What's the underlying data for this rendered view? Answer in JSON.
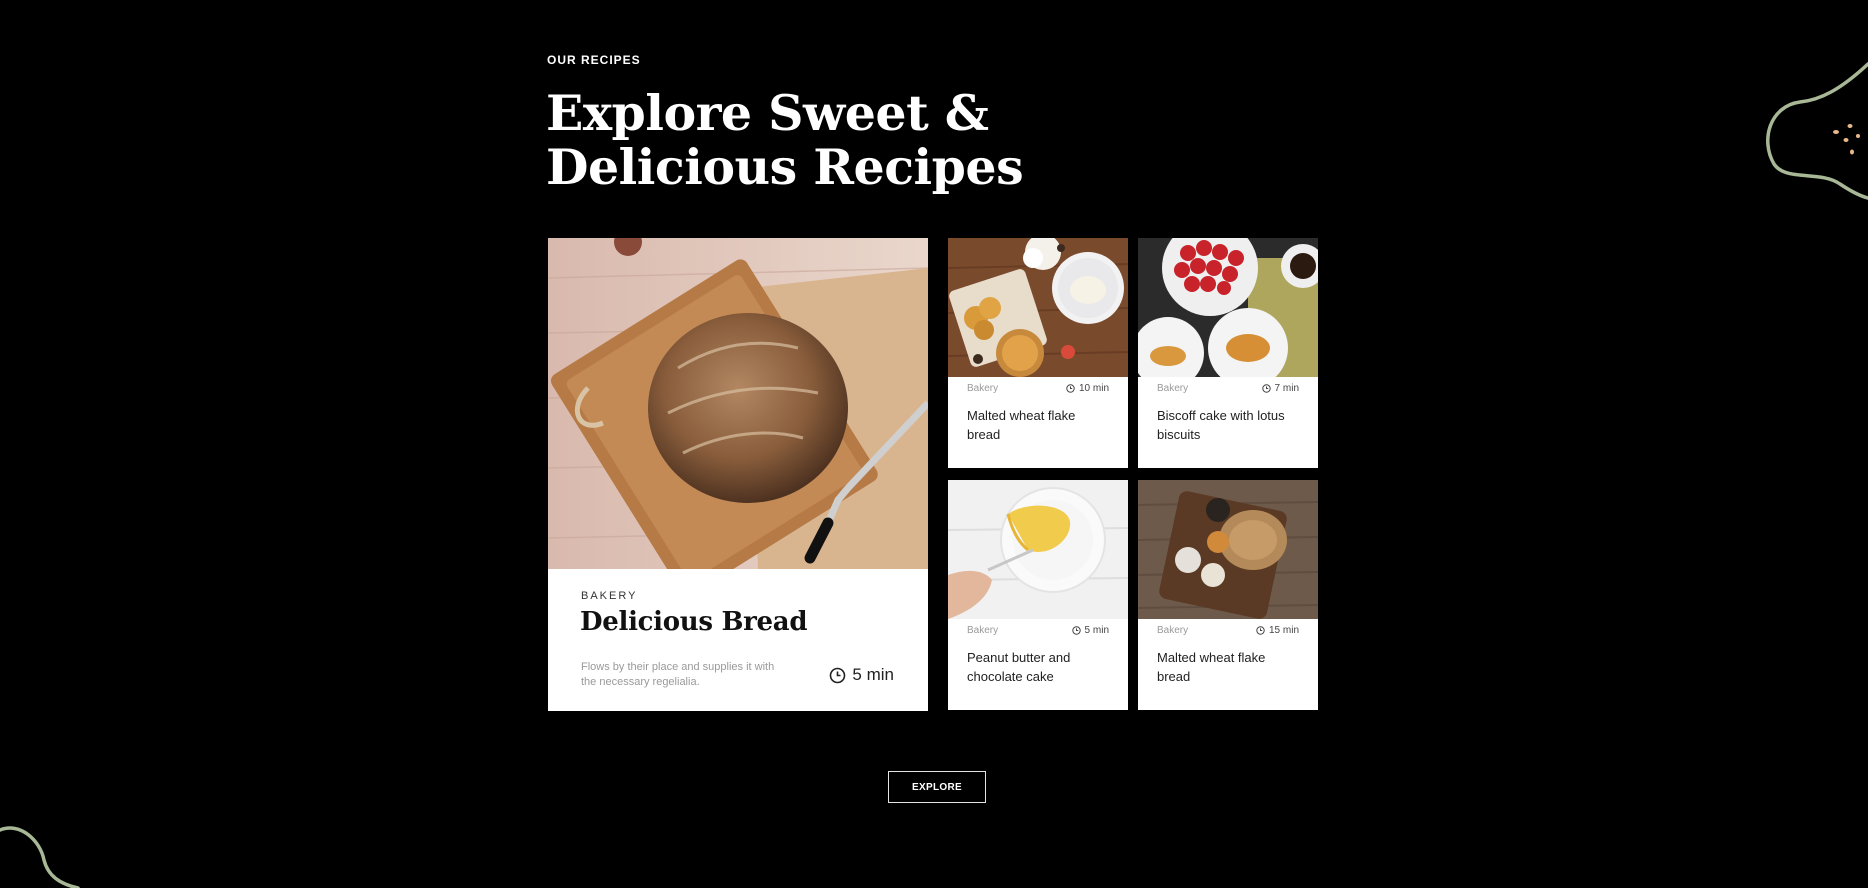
{
  "section": {
    "eyebrow": "OUR RECIPES",
    "title_line1": "Explore Sweet &",
    "title_line2": "Delicious Recipes"
  },
  "featured": {
    "image": "sourdough-bread-on-cutting-board",
    "category": "BAKERY",
    "title": "Delicious Bread",
    "description": "Flows by their place and supplies it with the necessary regelialia.",
    "time": "5 min",
    "time_icon": "clock-icon"
  },
  "recipes": [
    {
      "image": "pastries-and-pie-table",
      "category": "Bakery",
      "time": "10 min",
      "title": "Malted wheat flake bread"
    },
    {
      "image": "strawberries-and-croissants",
      "category": "Bakery",
      "time": "7 min",
      "title": "Biscoff cake with lotus biscuits"
    },
    {
      "image": "cake-slice-on-plate",
      "category": "Bakery",
      "time": "5 min",
      "title": "Peanut butter and chocolate cake"
    },
    {
      "image": "bread-board-with-condiments",
      "category": "Bakery",
      "time": "15 min",
      "title": "Malted wheat flake bread"
    }
  ],
  "cta": {
    "label": "EXPLORE"
  },
  "colors": {
    "background": "#000000",
    "card": "#ffffff",
    "decor_line": "#a8b896",
    "decor_dots": "#e7b98a"
  }
}
